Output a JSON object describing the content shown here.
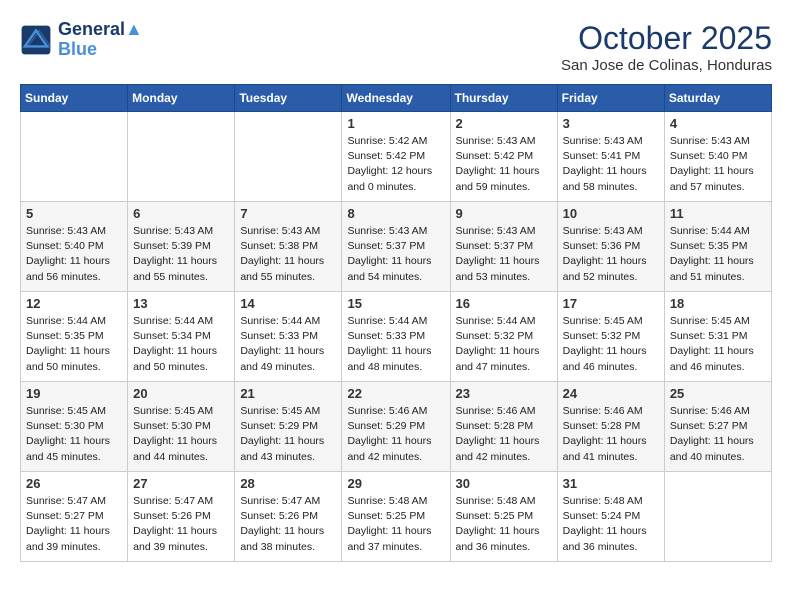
{
  "header": {
    "logo_line1": "General",
    "logo_line2": "Blue",
    "month": "October 2025",
    "location": "San Jose de Colinas, Honduras"
  },
  "days_of_week": [
    "Sunday",
    "Monday",
    "Tuesday",
    "Wednesday",
    "Thursday",
    "Friday",
    "Saturday"
  ],
  "weeks": [
    [
      {
        "day": "",
        "info": ""
      },
      {
        "day": "",
        "info": ""
      },
      {
        "day": "",
        "info": ""
      },
      {
        "day": "1",
        "info": "Sunrise: 5:42 AM\nSunset: 5:42 PM\nDaylight: 12 hours\nand 0 minutes."
      },
      {
        "day": "2",
        "info": "Sunrise: 5:43 AM\nSunset: 5:42 PM\nDaylight: 11 hours\nand 59 minutes."
      },
      {
        "day": "3",
        "info": "Sunrise: 5:43 AM\nSunset: 5:41 PM\nDaylight: 11 hours\nand 58 minutes."
      },
      {
        "day": "4",
        "info": "Sunrise: 5:43 AM\nSunset: 5:40 PM\nDaylight: 11 hours\nand 57 minutes."
      }
    ],
    [
      {
        "day": "5",
        "info": "Sunrise: 5:43 AM\nSunset: 5:40 PM\nDaylight: 11 hours\nand 56 minutes."
      },
      {
        "day": "6",
        "info": "Sunrise: 5:43 AM\nSunset: 5:39 PM\nDaylight: 11 hours\nand 55 minutes."
      },
      {
        "day": "7",
        "info": "Sunrise: 5:43 AM\nSunset: 5:38 PM\nDaylight: 11 hours\nand 55 minutes."
      },
      {
        "day": "8",
        "info": "Sunrise: 5:43 AM\nSunset: 5:37 PM\nDaylight: 11 hours\nand 54 minutes."
      },
      {
        "day": "9",
        "info": "Sunrise: 5:43 AM\nSunset: 5:37 PM\nDaylight: 11 hours\nand 53 minutes."
      },
      {
        "day": "10",
        "info": "Sunrise: 5:43 AM\nSunset: 5:36 PM\nDaylight: 11 hours\nand 52 minutes."
      },
      {
        "day": "11",
        "info": "Sunrise: 5:44 AM\nSunset: 5:35 PM\nDaylight: 11 hours\nand 51 minutes."
      }
    ],
    [
      {
        "day": "12",
        "info": "Sunrise: 5:44 AM\nSunset: 5:35 PM\nDaylight: 11 hours\nand 50 minutes."
      },
      {
        "day": "13",
        "info": "Sunrise: 5:44 AM\nSunset: 5:34 PM\nDaylight: 11 hours\nand 50 minutes."
      },
      {
        "day": "14",
        "info": "Sunrise: 5:44 AM\nSunset: 5:33 PM\nDaylight: 11 hours\nand 49 minutes."
      },
      {
        "day": "15",
        "info": "Sunrise: 5:44 AM\nSunset: 5:33 PM\nDaylight: 11 hours\nand 48 minutes."
      },
      {
        "day": "16",
        "info": "Sunrise: 5:44 AM\nSunset: 5:32 PM\nDaylight: 11 hours\nand 47 minutes."
      },
      {
        "day": "17",
        "info": "Sunrise: 5:45 AM\nSunset: 5:32 PM\nDaylight: 11 hours\nand 46 minutes."
      },
      {
        "day": "18",
        "info": "Sunrise: 5:45 AM\nSunset: 5:31 PM\nDaylight: 11 hours\nand 46 minutes."
      }
    ],
    [
      {
        "day": "19",
        "info": "Sunrise: 5:45 AM\nSunset: 5:30 PM\nDaylight: 11 hours\nand 45 minutes."
      },
      {
        "day": "20",
        "info": "Sunrise: 5:45 AM\nSunset: 5:30 PM\nDaylight: 11 hours\nand 44 minutes."
      },
      {
        "day": "21",
        "info": "Sunrise: 5:45 AM\nSunset: 5:29 PM\nDaylight: 11 hours\nand 43 minutes."
      },
      {
        "day": "22",
        "info": "Sunrise: 5:46 AM\nSunset: 5:29 PM\nDaylight: 11 hours\nand 42 minutes."
      },
      {
        "day": "23",
        "info": "Sunrise: 5:46 AM\nSunset: 5:28 PM\nDaylight: 11 hours\nand 42 minutes."
      },
      {
        "day": "24",
        "info": "Sunrise: 5:46 AM\nSunset: 5:28 PM\nDaylight: 11 hours\nand 41 minutes."
      },
      {
        "day": "25",
        "info": "Sunrise: 5:46 AM\nSunset: 5:27 PM\nDaylight: 11 hours\nand 40 minutes."
      }
    ],
    [
      {
        "day": "26",
        "info": "Sunrise: 5:47 AM\nSunset: 5:27 PM\nDaylight: 11 hours\nand 39 minutes."
      },
      {
        "day": "27",
        "info": "Sunrise: 5:47 AM\nSunset: 5:26 PM\nDaylight: 11 hours\nand 39 minutes."
      },
      {
        "day": "28",
        "info": "Sunrise: 5:47 AM\nSunset: 5:26 PM\nDaylight: 11 hours\nand 38 minutes."
      },
      {
        "day": "29",
        "info": "Sunrise: 5:48 AM\nSunset: 5:25 PM\nDaylight: 11 hours\nand 37 minutes."
      },
      {
        "day": "30",
        "info": "Sunrise: 5:48 AM\nSunset: 5:25 PM\nDaylight: 11 hours\nand 36 minutes."
      },
      {
        "day": "31",
        "info": "Sunrise: 5:48 AM\nSunset: 5:24 PM\nDaylight: 11 hours\nand 36 minutes."
      },
      {
        "day": "",
        "info": ""
      }
    ]
  ]
}
